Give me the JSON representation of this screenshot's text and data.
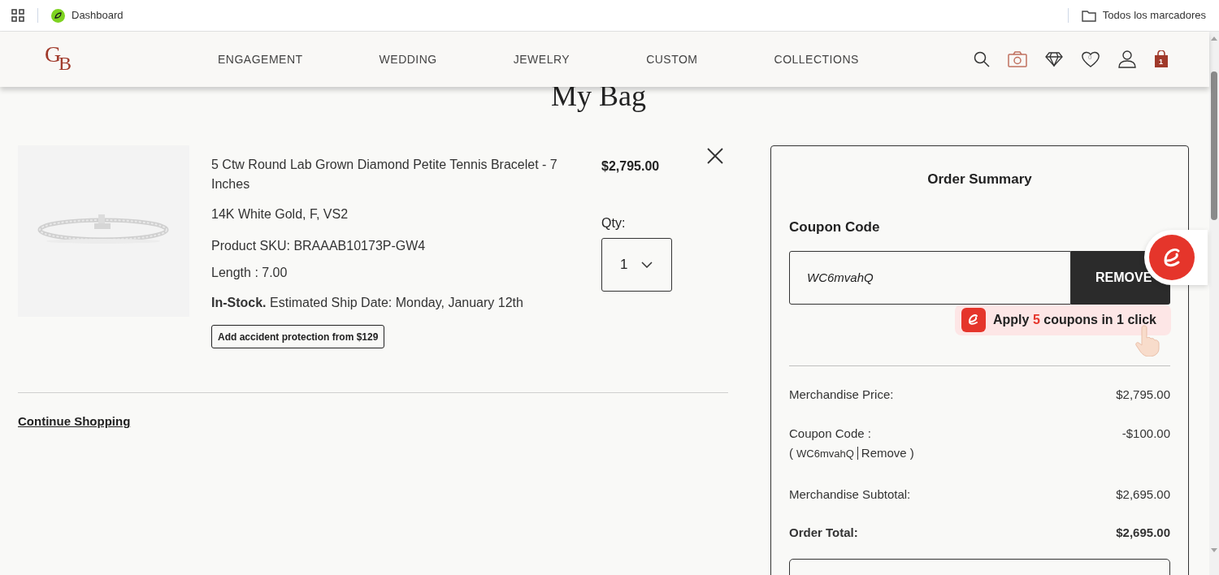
{
  "bookmarks_bar": {
    "bookmark": "Dashboard",
    "folder": "Todos los marcadores"
  },
  "header": {
    "logo": [
      "G",
      "B"
    ],
    "nav": [
      {
        "label": "ENGAGEMENT"
      },
      {
        "label": "WEDDING"
      },
      {
        "label": "JEWELRY"
      },
      {
        "label": "CUSTOM"
      },
      {
        "label": "COLLECTIONS"
      }
    ],
    "wishlist_count": "0",
    "bag_count": "1"
  },
  "page_title": "My Bag",
  "cart_item": {
    "name": "5 Ctw Round Lab Grown Diamond Petite Tennis Bracelet - 7 Inches",
    "variant": "14K White Gold, F, VS2",
    "sku": "Product SKU: BRAAAB10173P-GW4",
    "length": "Length : 7.00",
    "stock": "In-Stock.",
    "ship_date": "Estimated Ship Date: Monday, January 12th",
    "protection_button": "Add accident protection from $129",
    "price": "$2,795.00",
    "qty_label": "Qty:",
    "qty": "1"
  },
  "continue_link": "Continue Shopping",
  "order_summary": {
    "title": "Order Summary",
    "coupon_label": "Coupon Code",
    "coupon_value": "WC6mvahQ",
    "coupon_button": "REMOVE",
    "lines": [
      {
        "label": "Merchandise Price:",
        "value": "$2,795.00",
        "bold": false
      },
      {
        "label": "Coupon Code :",
        "open": "(",
        "code": "WC6mvahQ",
        "remove": "Remove",
        "close": ")",
        "value": "-$100.00",
        "bold": false
      },
      {
        "label": "Merchandise Subtotal:",
        "value": "$2,695.00",
        "bold": false
      },
      {
        "label": "Order Total:",
        "value": "$2,695.00",
        "bold": true
      }
    ]
  },
  "coupon_extension": {
    "prefix": "Apply",
    "count": "5",
    "suffix": "coupons in 1 click"
  }
}
